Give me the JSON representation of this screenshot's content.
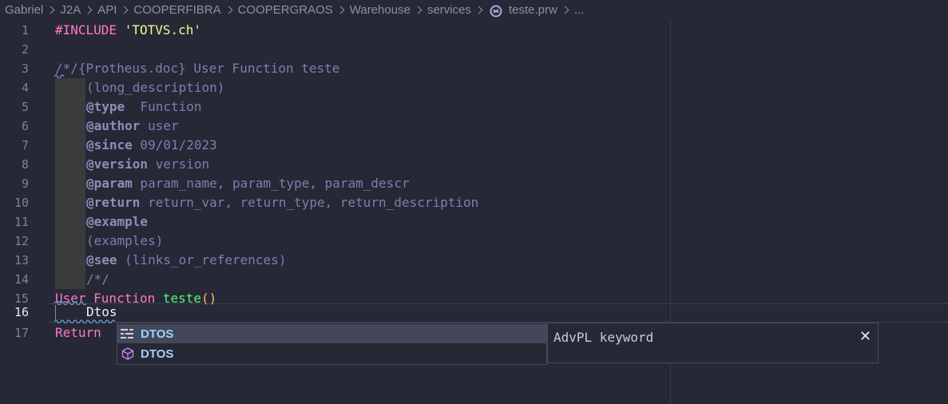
{
  "breadcrumb": {
    "segments": [
      "Gabriel",
      "J2A",
      "API",
      "COOPERFIBRA",
      "COOPERGRAOS",
      "Warehouse",
      "services"
    ],
    "file": "teste.prw",
    "more": "..."
  },
  "editor": {
    "active_line": "16",
    "lines": [
      {
        "num": "1",
        "parts": [
          "#INCLUDE ",
          "'TOTVS.ch'"
        ]
      },
      {
        "num": "2",
        "parts": []
      },
      {
        "num": "3",
        "parts": [
          "/*/{Protheus.doc} User Function teste"
        ]
      },
      {
        "num": "4",
        "parts": [
          "(long_description)"
        ]
      },
      {
        "num": "5",
        "parts": [
          "@type",
          "  Function"
        ]
      },
      {
        "num": "6",
        "parts": [
          "@author",
          " user"
        ]
      },
      {
        "num": "7",
        "parts": [
          "@since",
          " 09/01/2023"
        ]
      },
      {
        "num": "8",
        "parts": [
          "@version",
          " version"
        ]
      },
      {
        "num": "9",
        "parts": [
          "@param",
          " param_name, param_type, param_descr"
        ]
      },
      {
        "num": "10",
        "parts": [
          "@return",
          " return_var, return_type, return_description"
        ]
      },
      {
        "num": "11",
        "parts": [
          "@example"
        ]
      },
      {
        "num": "12",
        "parts": [
          "(examples)"
        ]
      },
      {
        "num": "13",
        "parts": [
          "@see",
          " (links_or_references)"
        ]
      },
      {
        "num": "14",
        "parts": [
          "/*/"
        ]
      },
      {
        "num": "15",
        "parts": [
          "User Function ",
          "teste",
          "()"
        ]
      },
      {
        "num": "16",
        "parts": [
          "Dtos"
        ]
      },
      {
        "num": "17",
        "parts": [
          "Return"
        ]
      }
    ]
  },
  "suggest": {
    "items": [
      {
        "label": "DTOS",
        "icon": "keyword-icon"
      },
      {
        "label": "DTOS",
        "icon": "method-cube-icon"
      }
    ],
    "detail": "AdvPL keyword",
    "close_icon": "close-icon",
    "close_glyph": "✕"
  },
  "colors": {
    "background": "#262835",
    "preprocessor": "#ff79c6",
    "string": "#f1fa8c",
    "comment": "#7a80b0",
    "function_name": "#50fa7b",
    "suggest_text": "#9fd2ff"
  }
}
